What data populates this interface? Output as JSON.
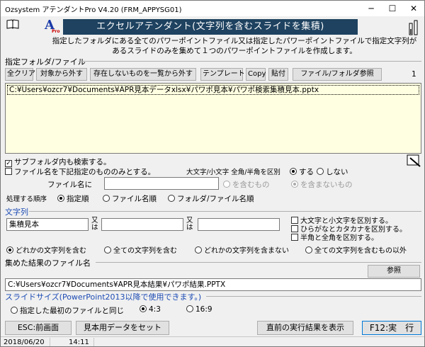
{
  "window": {
    "title": "Ozsystem アテンダントPro V4.20 (FRM_APPYSG01)",
    "minimize": "─",
    "maximize": "☐",
    "close": "✕"
  },
  "header": {
    "logo_letter": "A",
    "logo_sub": "Pro",
    "title": "エクセルアテンダント(文字列を含むスライドを集積)",
    "desc_line1": "指定したフォルダにある全てのパワーポイントファイル又は指定したパワーポイントファイルで指定文字列が",
    "desc_line2": "あるスライドのみを集めて１つのパワーポイントファイルを作成します。"
  },
  "folder": {
    "section_label": "指定フォルダ/ファイル",
    "buttons": [
      "全クリア",
      "対象から外す",
      "存在しないものを一覧から外す",
      "テンプレート",
      "Copy",
      "貼付",
      "ファイル/フォルダ参照"
    ],
    "count": "1",
    "items": [
      "C:¥Users¥ozcr7¥Documents¥APR見本データxlsx¥パワポ見本¥パワポ検索集積見本.pptx"
    ]
  },
  "options": {
    "include_subfolders": "サブフォルダ内も検索する。",
    "filename_filter": "ファイル名を下記指定のもののみとする。",
    "case_label": "大文字/小文字 全角/半角を区別",
    "case_yes": "する",
    "case_no": "しない",
    "filename_label": "ファイル名に",
    "filename_value": "",
    "contains": "を含むもの",
    "not_contains": "を含まないもの"
  },
  "order": {
    "label": "処理する順序",
    "opt1": "指定順",
    "opt2": "ファイル名順",
    "opt3": "フォルダ/ファイル名順"
  },
  "strings": {
    "section_label": "文字列",
    "field1": "集積見本",
    "or_label": "又は",
    "field2": "",
    "field3": "",
    "chk1": "大文字と小文字を区別する。",
    "chk2": "ひらがなとカタカナを区別する。",
    "chk3": "半角と全角を区別する。",
    "mode1": "どれかの文字列を含む",
    "mode2": "全ての文字列を含む",
    "mode3": "どれかの文字列を含まない",
    "mode4": "全ての文字列を含むもの以外"
  },
  "result": {
    "section_label": "集めた結果のファイル名",
    "browse": "参照",
    "path": "C:¥Users¥ozcr7¥Documents¥APR見本結果¥パワポ結果.PPTX"
  },
  "slide": {
    "section_label": "スライドサイズ(PowerPoint2013以降で使用できます。)",
    "opt1": "指定した最初のファイルと同じ",
    "opt2": "4:3",
    "opt3": "16:9"
  },
  "actions": {
    "back": "ESC:前画面",
    "sample": "見本用データをセット",
    "last_result": "直前の実行結果を表示",
    "run": "F12:実　行"
  },
  "status": {
    "date": "2018/06/20",
    "time": "14:11"
  }
}
